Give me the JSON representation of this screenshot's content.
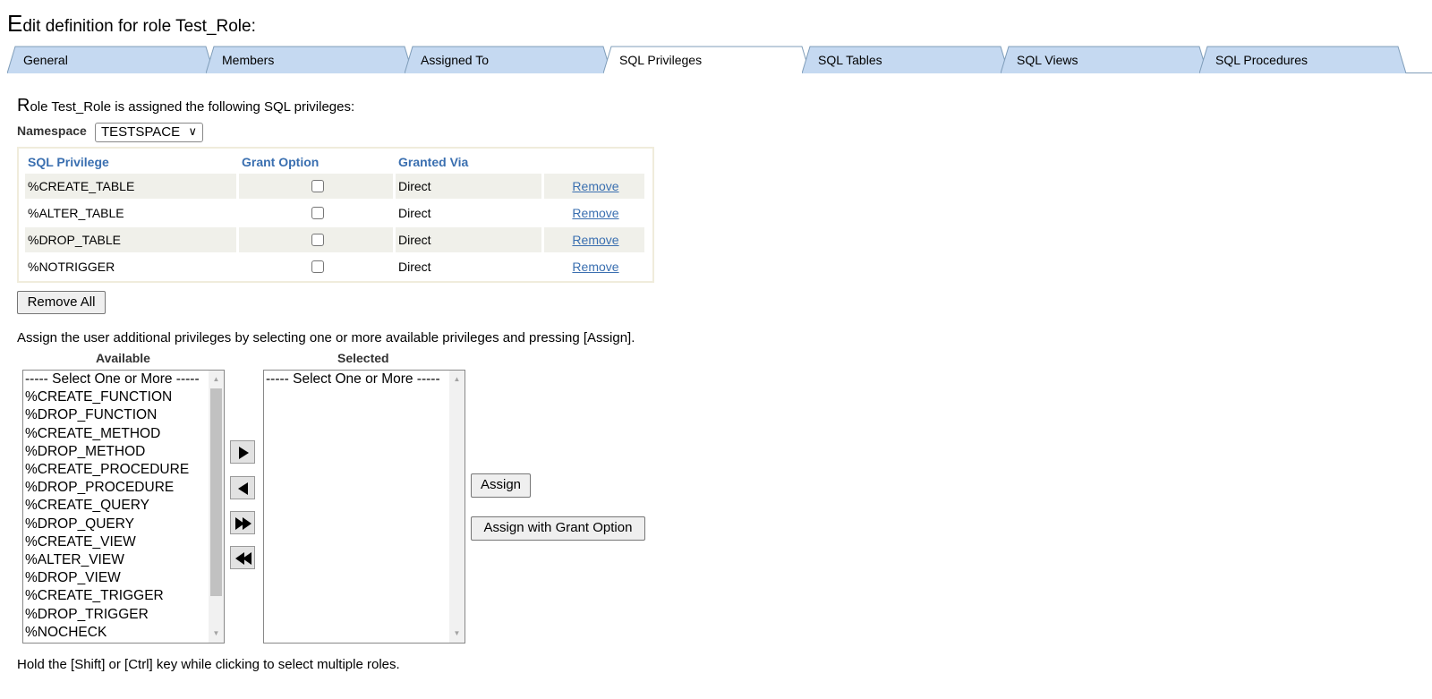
{
  "page": {
    "title_initial": "E",
    "title_rest": "dit definition for role Test_Role:"
  },
  "tabs": [
    {
      "label": "General",
      "active": false
    },
    {
      "label": "Members",
      "active": false
    },
    {
      "label": "Assigned To",
      "active": false
    },
    {
      "label": "SQL Privileges",
      "active": true
    },
    {
      "label": "SQL Tables",
      "active": false
    },
    {
      "label": "SQL Views",
      "active": false
    },
    {
      "label": "SQL Procedures",
      "active": false
    }
  ],
  "section": {
    "desc_initial": "R",
    "desc_rest": "ole Test_Role is assigned the following SQL privileges:",
    "namespace_label": "Namespace",
    "namespace_value": "TESTSPACE"
  },
  "privileges_table": {
    "headers": [
      "SQL Privilege",
      "Grant Option",
      "Granted Via",
      ""
    ],
    "rows": [
      {
        "privilege": "%CREATE_TABLE",
        "grant_option": false,
        "granted_via": "Direct",
        "action": "Remove"
      },
      {
        "privilege": "%ALTER_TABLE",
        "grant_option": false,
        "granted_via": "Direct",
        "action": "Remove"
      },
      {
        "privilege": "%DROP_TABLE",
        "grant_option": false,
        "granted_via": "Direct",
        "action": "Remove"
      },
      {
        "privilege": "%NOTRIGGER",
        "grant_option": false,
        "granted_via": "Direct",
        "action": "Remove"
      }
    ]
  },
  "remove_all_label": "Remove All",
  "assign_instructions": "Assign the user additional privileges by selecting one or more available privileges and pressing [Assign].",
  "available": {
    "header": "Available",
    "items": [
      "----- Select One or More -----",
      "%CREATE_FUNCTION",
      "%DROP_FUNCTION",
      "%CREATE_METHOD",
      "%DROP_METHOD",
      "%CREATE_PROCEDURE",
      "%DROP_PROCEDURE",
      "%CREATE_QUERY",
      "%DROP_QUERY",
      "%CREATE_VIEW",
      "%ALTER_VIEW",
      "%DROP_VIEW",
      "%CREATE_TRIGGER",
      "%DROP_TRIGGER",
      "%NOCHECK"
    ]
  },
  "selected": {
    "header": "Selected",
    "items": [
      "----- Select One or More -----"
    ]
  },
  "buttons": {
    "assign": "Assign",
    "assign_grant": "Assign with Grant Option"
  },
  "footnote": "Hold the [Shift] or [Ctrl] key while clicking to select multiple roles.",
  "colors": {
    "tab_fill": "#c5d9f1",
    "tab_active_fill": "#ffffff",
    "tab_border": "#7f9db9",
    "header_text": "#3a6fb0",
    "row_shade": "#f0f0ea"
  }
}
